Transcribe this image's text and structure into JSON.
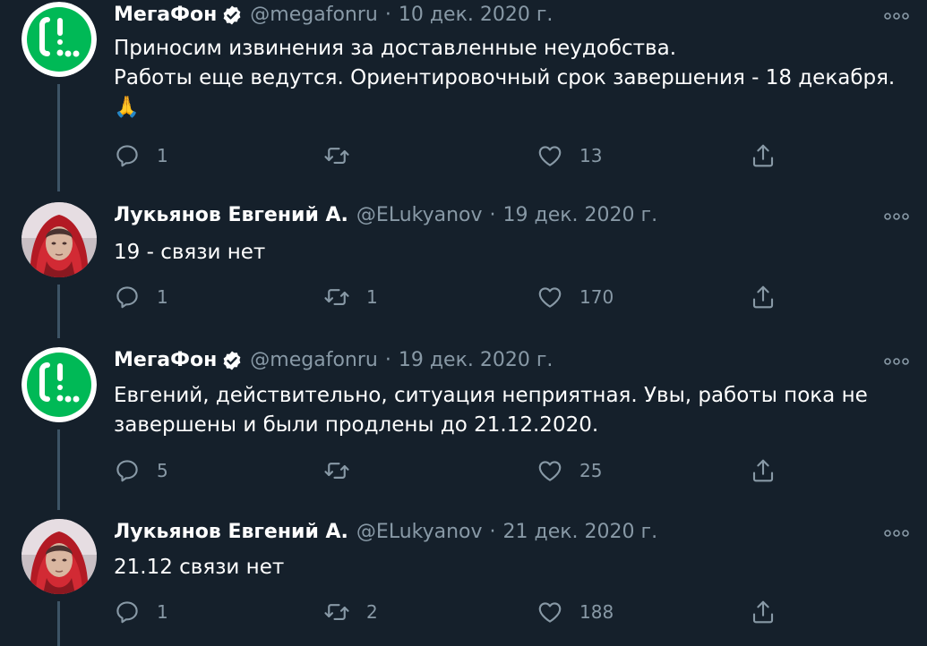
{
  "tweets": [
    {
      "author": "МегаФон",
      "handle": "@megafonru",
      "separator": "·",
      "date": "10 дек. 2020 г.",
      "verified": true,
      "avatar_icon": "megafon-logo-icon",
      "lines": [
        "Приносим извинения за доставленные неудобства.",
        "Работы еще ведутся. Ориентировочный срок завершения - 18 декабря.",
        "🙏"
      ],
      "replies": "1",
      "retweets": "",
      "likes": "13"
    },
    {
      "author": "Лукьянов Евгений А.",
      "handle": "@ELukyanov",
      "separator": "·",
      "date": "19 дек. 2020 г.",
      "verified": false,
      "avatar_icon": "user-photo-avatar",
      "lines": [
        "19 - связи нет"
      ],
      "replies": "1",
      "retweets": "1",
      "likes": "170"
    },
    {
      "author": "МегаФон",
      "handle": "@megafonru",
      "separator": "·",
      "date": "19 дек. 2020 г.",
      "verified": true,
      "avatar_icon": "megafon-logo-icon",
      "lines": [
        "Евгений, действительно, ситуация неприятная. Увы, работы пока не",
        "завершены и были продлены до 21.12.2020."
      ],
      "replies": "5",
      "retweets": "",
      "likes": "25"
    },
    {
      "author": "Лукьянов Евгений А.",
      "handle": "@ELukyanov",
      "separator": "·",
      "date": "21 дек. 2020 г.",
      "verified": false,
      "avatar_icon": "user-photo-avatar",
      "lines": [
        "21.12 связи нет"
      ],
      "replies": "1",
      "retweets": "2",
      "likes": "188"
    }
  ],
  "colors": {
    "background": "#15202b",
    "text": "#ffffff",
    "secondary": "#8899a6",
    "megafon_green": "#00b956",
    "verified_fill": "#ffffff",
    "thread_line": "#3d5466"
  }
}
